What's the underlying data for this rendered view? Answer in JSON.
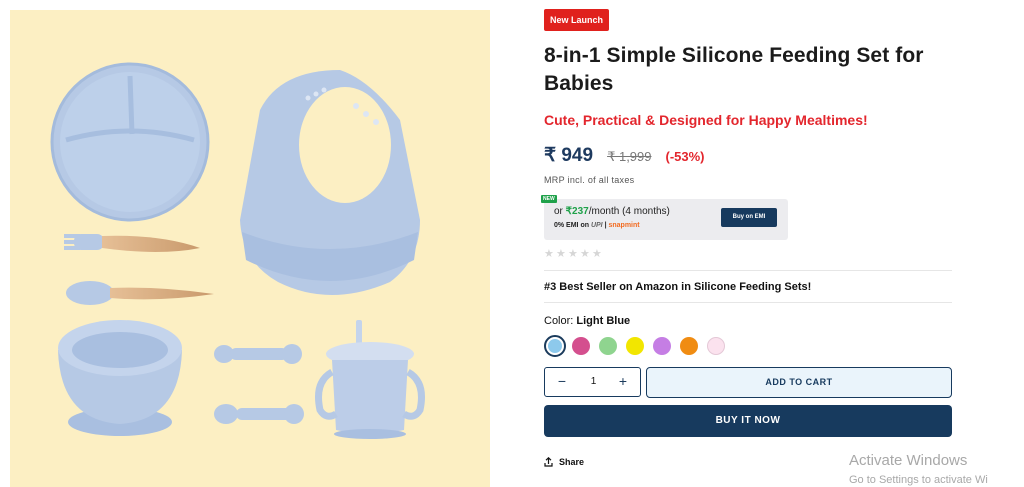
{
  "product": {
    "badge": "New Launch",
    "title": "8-in-1 Simple Silicone Feeding Set for Babies",
    "tagline": "Cute, Practical & Designed for Happy Mealtimes!",
    "price": "₹ 949",
    "mrp": "₹ 1,999",
    "discount": "(-53%)",
    "tax_note": "MRP incl. of all taxes",
    "rating_stars": 0,
    "bestseller": "#3 Best Seller on Amazon in Silicone Feeding Sets!"
  },
  "emi": {
    "new_tag": "NEW",
    "prefix": "or ",
    "amount": "₹237",
    "suffix": "/month (4 months)",
    "line2_prefix": "0% EMI on ",
    "upi": "UPI",
    "separator": " | ",
    "snap": "snapmint",
    "button": "Buy on EMI"
  },
  "color": {
    "label": "Color:",
    "selected_name": "Light Blue",
    "swatches": [
      {
        "name": "Light Blue",
        "hex": "#8dc9ec",
        "selected": true
      },
      {
        "name": "Pink",
        "hex": "#d44f8e",
        "selected": false
      },
      {
        "name": "Green",
        "hex": "#8fd48f",
        "selected": false
      },
      {
        "name": "Yellow",
        "hex": "#f2e600",
        "selected": false
      },
      {
        "name": "Purple",
        "hex": "#c57ee4",
        "selected": false
      },
      {
        "name": "Orange",
        "hex": "#f08c12",
        "selected": false
      },
      {
        "name": "Light Pink",
        "hex": "#fbe2ee",
        "selected": false
      }
    ]
  },
  "cart": {
    "quantity": "1",
    "minus": "−",
    "plus": "+",
    "add_to_cart": "ADD TO CART",
    "buy_now": "BUY IT NOW"
  },
  "share_label": "Share",
  "watermark": {
    "title": "Activate Windows",
    "subtitle": "Go to Settings to activate Wi"
  },
  "colors": {
    "brand_navy": "#173a5e",
    "accent_red": "#e3262d",
    "image_bg": "#fcefc3",
    "silicone_blue": "#b9cbe6"
  }
}
